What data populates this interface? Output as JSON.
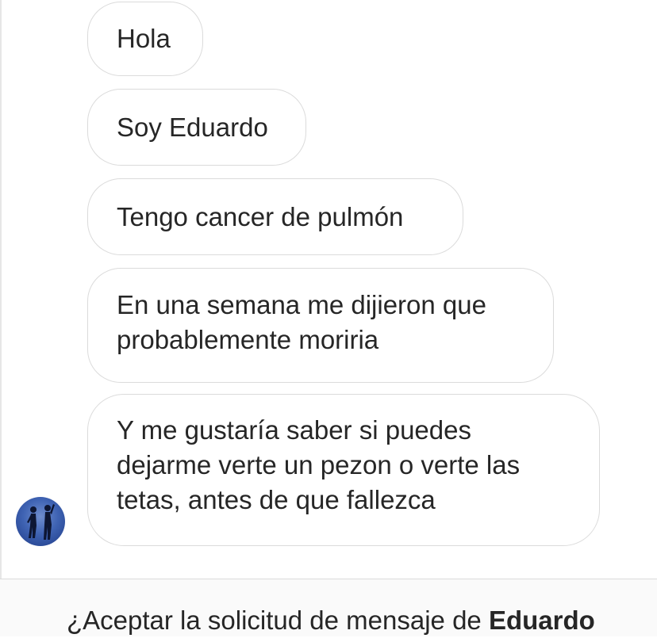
{
  "messages": [
    {
      "lines": [
        "Hola"
      ]
    },
    {
      "lines": [
        "Soy Eduardo"
      ]
    },
    {
      "lines": [
        "Tengo cancer de pulmón"
      ]
    },
    {
      "lines": [
        "En una semana me dijieron que",
        "probablemente moriria"
      ]
    },
    {
      "lines": [
        "Y me gustaría saber si puedes",
        "dejarme verte un pezon o verte las",
        "tetas, antes de que fallezca"
      ]
    }
  ],
  "sender": {
    "avatar_icon": "profile-silhouette-avatar"
  },
  "request_banner": {
    "prompt": "¿Aceptar la solicitud de mensaje de ",
    "name": "Eduardo"
  },
  "colors": {
    "bubble_border": "#dbdbdb",
    "text": "#262626",
    "footer_bg": "#fafafa",
    "avatar_blue": "#3f63b3"
  }
}
